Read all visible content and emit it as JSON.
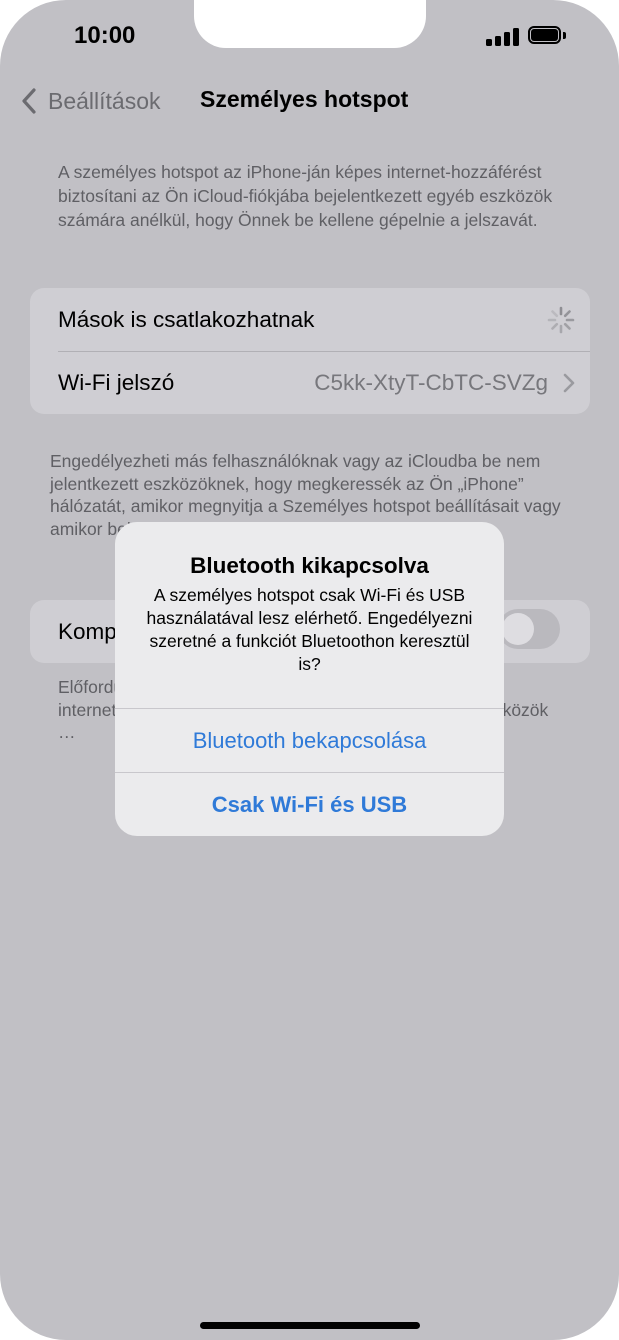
{
  "status_bar": {
    "time": "10:00",
    "signal_icon": "cellular-signal-icon",
    "battery_icon": "battery-full-icon"
  },
  "nav": {
    "back_label": "Beállítások",
    "title": "Személyes hotspot"
  },
  "intro_text": "A személyes hotspot az iPhone-ján képes internet-hozzáférést biztosítani az Ön iCloud-fiókjába bejelentkezett egyéb eszközök számára anélkül, hogy Önnek be kellene gépelnie a jelszavát.",
  "settings_group": {
    "allow_others_label": "Mások is csatlakozhatnak",
    "wifi_password_label": "Wi-Fi jelszó",
    "wifi_password_value": "C5kk-XtyT-CbTC-SVZg"
  },
  "footnote_1": "Engedélyezheti más felhasználóknak vagy az iCloudba be nem jelentkezett eszközöknek, hogy megkeressék az Ön „iPhone” hálózatát, amikor megnyitja a Személyes hotspot beállításait vagy amikor bekapcsolja a Vezérlőközpontban.",
  "compat_group": {
    "label": "Kompatibilitás maximalizálása",
    "toggle_on": false
  },
  "footnote_2": "Előfordulhat, hogy a hotspothoz csatlakozó eszközök internetkapcsolata lassabb lesz, ha ehhez csatlakozó eszközök …",
  "alert": {
    "title": "Bluetooth kikapcsolva",
    "message": "A személyes hotspot csak Wi-Fi és USB használatával lesz elérhető. Engedélyezni szeretné a funkciót Bluetoothon keresztül is?",
    "button_primary": "Bluetooth bekapcsolása",
    "button_secondary": "Csak Wi-Fi és USB"
  },
  "colors": {
    "background": "#c1c0c5",
    "group_background": "#cfced3",
    "alert_background": "#ebebed",
    "accent": "#2f7ad8"
  }
}
